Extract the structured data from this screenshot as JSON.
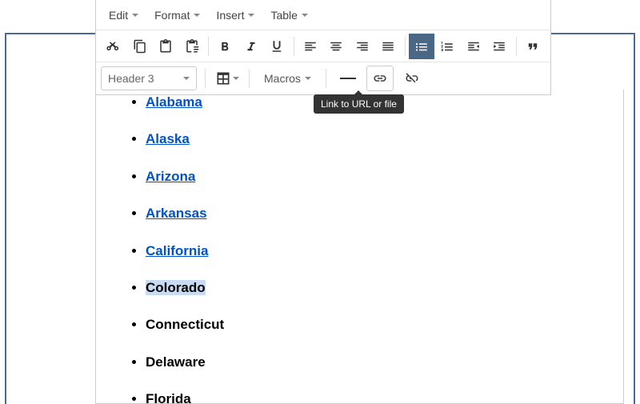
{
  "menus": {
    "edit": "Edit",
    "format": "Format",
    "insert": "Insert",
    "table": "Table"
  },
  "header_select": {
    "label": "Header 3"
  },
  "macros_label": "Macros",
  "tooltip": {
    "link": "Link to URL or file"
  },
  "states": [
    {
      "name": "Alabama",
      "linked": true
    },
    {
      "name": "Alaska",
      "linked": true
    },
    {
      "name": "Arizona",
      "linked": true
    },
    {
      "name": "Arkansas",
      "linked": true
    },
    {
      "name": "California",
      "linked": true
    },
    {
      "name": "Colorado",
      "linked": false,
      "selected": true
    },
    {
      "name": "Connecticut",
      "linked": false
    },
    {
      "name": "Delaware",
      "linked": false
    },
    {
      "name": "Florida",
      "linked": false
    }
  ]
}
